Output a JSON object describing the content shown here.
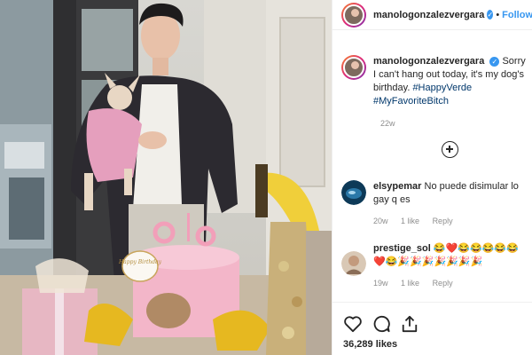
{
  "post": {
    "username": "manologonzalezvergara",
    "follow_label": "Follow",
    "caption_text": "Sorry I can't hang out today, it's my dog's birthday.",
    "caption_tags": [
      "#HappyVerde",
      "#MyFavoriteBitch"
    ],
    "caption_age": "22w",
    "likes": "36,289 likes"
  },
  "comments": [
    {
      "username": "elsypemar",
      "text": "No puede disimular lo gay q es",
      "age": "20w",
      "likes": "1 like",
      "reply": "Reply"
    },
    {
      "username": "prestige_sol",
      "text": "😂❤️😂😂😂😂😂❤️😂🎉🎉🎉🎉🎉🎉🎉",
      "age": "19w",
      "likes": "1 like",
      "reply": "Reply"
    }
  ],
  "photo": {
    "sign_text": "Happy Birthday"
  },
  "colors": {
    "accent": "#3897f0",
    "hashtag": "#00376b",
    "muted": "#8e8e8e"
  },
  "icons": [
    "heart-icon",
    "comment-icon",
    "share-icon",
    "add-comment-icon",
    "verified-icon"
  ]
}
